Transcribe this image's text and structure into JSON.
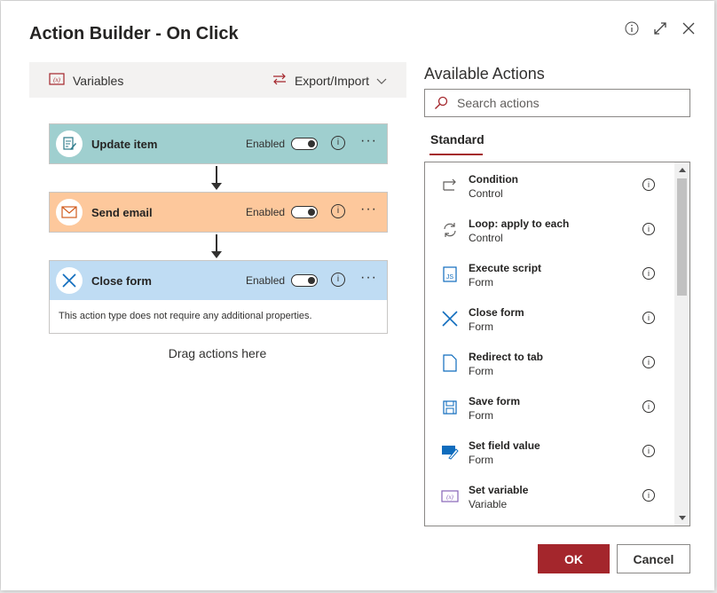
{
  "dialog": {
    "title": "Action Builder - On Click"
  },
  "toolbar": {
    "variables_label": "Variables",
    "export_label": "Export/Import"
  },
  "actions": [
    {
      "title": "Update item",
      "status": "Enabled",
      "color": "#9fcfcf"
    },
    {
      "title": "Send email",
      "status": "Enabled",
      "color": "#fdc89c"
    },
    {
      "title": "Close form",
      "status": "Enabled",
      "color": "#bfdcf3",
      "body": "This action type does not require any additional properties."
    }
  ],
  "drag_hint": "Drag actions here",
  "available": {
    "title": "Available Actions",
    "search_placeholder": "Search actions",
    "tab": "Standard",
    "items": [
      {
        "title": "Condition",
        "category": "Control",
        "icon": "condition-icon"
      },
      {
        "title": "Loop: apply to each",
        "category": "Control",
        "icon": "loop-icon"
      },
      {
        "title": "Execute script",
        "category": "Form",
        "icon": "script-icon"
      },
      {
        "title": "Close form",
        "category": "Form",
        "icon": "close-form-icon"
      },
      {
        "title": "Redirect to tab",
        "category": "Form",
        "icon": "page-icon"
      },
      {
        "title": "Save form",
        "category": "Form",
        "icon": "save-icon"
      },
      {
        "title": "Set field value",
        "category": "Form",
        "icon": "edit-field-icon"
      },
      {
        "title": "Set variable",
        "category": "Variable",
        "icon": "variable-icon"
      }
    ]
  },
  "buttons": {
    "ok": "OK",
    "cancel": "Cancel"
  },
  "colors": {
    "accent": "#a4262c"
  }
}
